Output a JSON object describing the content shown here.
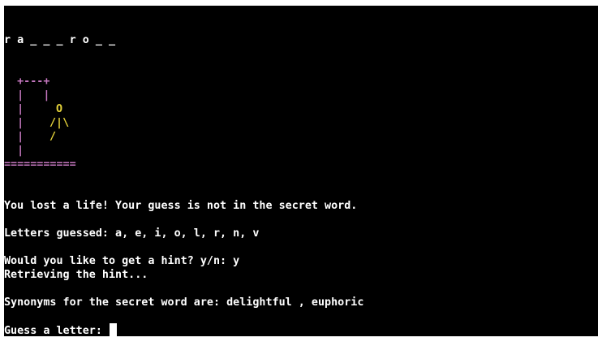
{
  "terminal": {
    "word_display": "r a _ _ _ r o _ _",
    "gallows": {
      "top": "  +---+",
      "rope": "  |   |",
      "post": "  |",
      "base": "==========="
    },
    "figure": {
      "head": "O",
      "torso": "/|\\",
      "legs": "/"
    },
    "messages": {
      "lost_life": "You lost a life! Your guess is not in the secret word.",
      "letters_guessed": "Letters guessed: a, e, i, o, l, r, n, v",
      "hint_prompt": "Would you like to get a hint? y/n: y",
      "retrieving": "Retrieving the hint...",
      "synonyms": "Synonyms for the secret word are: delightful , euphoric",
      "guess_prompt": "Guess a letter: "
    },
    "colors": {
      "background": "#000000",
      "text": "#ffffff",
      "gallows": "#c678c0",
      "figure": "#e5d33a"
    }
  }
}
